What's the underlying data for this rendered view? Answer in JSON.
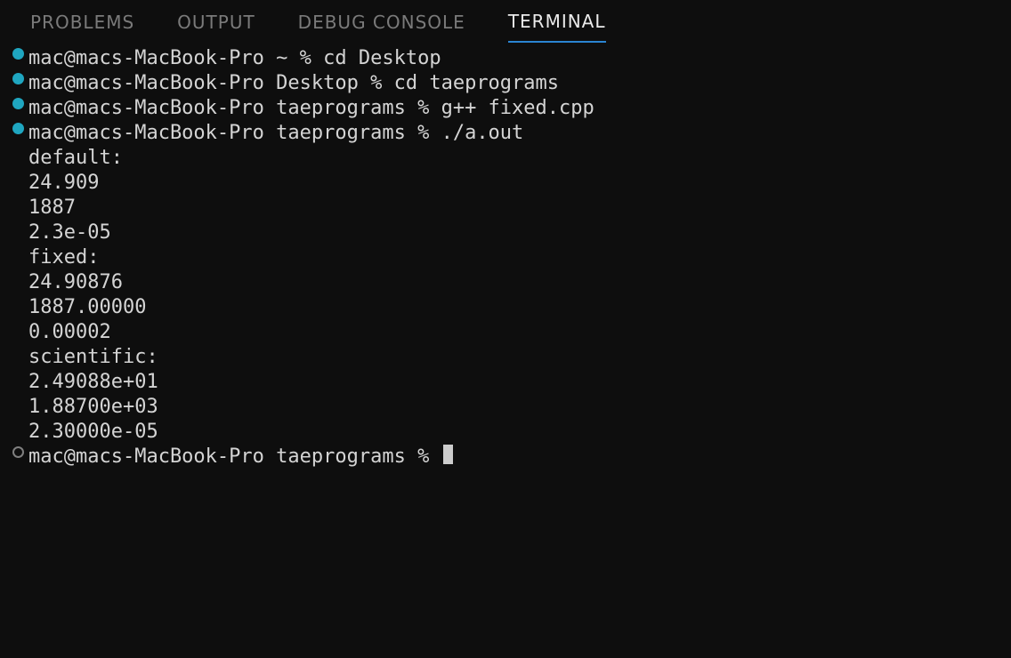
{
  "tabs": {
    "problems": "PROBLEMS",
    "output": "OUTPUT",
    "debug_console": "DEBUG CONSOLE",
    "terminal": "TERMINAL"
  },
  "terminal": {
    "lines": [
      {
        "bullet": "dot",
        "text": "mac@macs-MacBook-Pro ~ % cd Desktop"
      },
      {
        "bullet": "dot",
        "text": "mac@macs-MacBook-Pro Desktop % cd taeprograms"
      },
      {
        "bullet": "dot",
        "text": "mac@macs-MacBook-Pro taeprograms % g++ fixed.cpp"
      },
      {
        "bullet": "dot",
        "text": "mac@macs-MacBook-Pro taeprograms % ./a.out"
      },
      {
        "bullet": "none",
        "text": "default:"
      },
      {
        "bullet": "none",
        "text": "24.909"
      },
      {
        "bullet": "none",
        "text": "1887"
      },
      {
        "bullet": "none",
        "text": "2.3e-05"
      },
      {
        "bullet": "none",
        "text": ""
      },
      {
        "bullet": "none",
        "text": "fixed:"
      },
      {
        "bullet": "none",
        "text": "24.90876"
      },
      {
        "bullet": "none",
        "text": "1887.00000"
      },
      {
        "bullet": "none",
        "text": "0.00002"
      },
      {
        "bullet": "none",
        "text": ""
      },
      {
        "bullet": "none",
        "text": "scientific:"
      },
      {
        "bullet": "none",
        "text": "2.49088e+01"
      },
      {
        "bullet": "none",
        "text": "1.88700e+03"
      },
      {
        "bullet": "none",
        "text": "2.30000e-05"
      },
      {
        "bullet": "ring",
        "text": "mac@macs-MacBook-Pro taeprograms % ",
        "cursor": true
      }
    ]
  }
}
